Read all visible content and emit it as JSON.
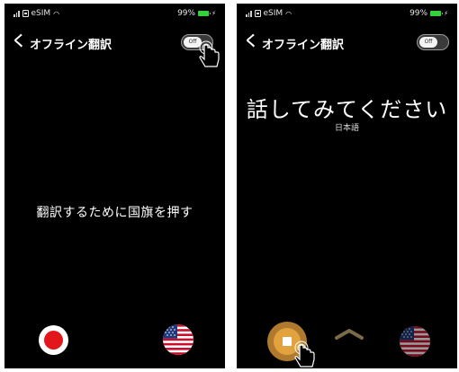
{
  "screens": [
    {
      "status": {
        "carrier": "eSIM",
        "battery": "99%"
      },
      "nav": {
        "back_label": "く",
        "title": "オフライン翻訳"
      },
      "toggle": {
        "label": "Off"
      },
      "prompt": "翻訳するために国旗を押す",
      "icons": [
        "record-icon",
        "us-flag-icon",
        "hand-tap-icon"
      ]
    },
    {
      "status": {
        "carrier": "eSIM",
        "battery": "99%"
      },
      "nav": {
        "back_label": "く",
        "title": "オフライン翻訳"
      },
      "toggle": {
        "label": "Off"
      },
      "speak_prompt": "話してみてください",
      "language": "日本語",
      "icons": [
        "stop-icon",
        "chevron-up-icon",
        "us-flag-icon",
        "hand-tap-icon"
      ]
    }
  ],
  "colors": {
    "background": "#000000",
    "record_red": "#e3171b",
    "stop_orange": "#e2a33e",
    "battery_green": "#35d13c"
  }
}
